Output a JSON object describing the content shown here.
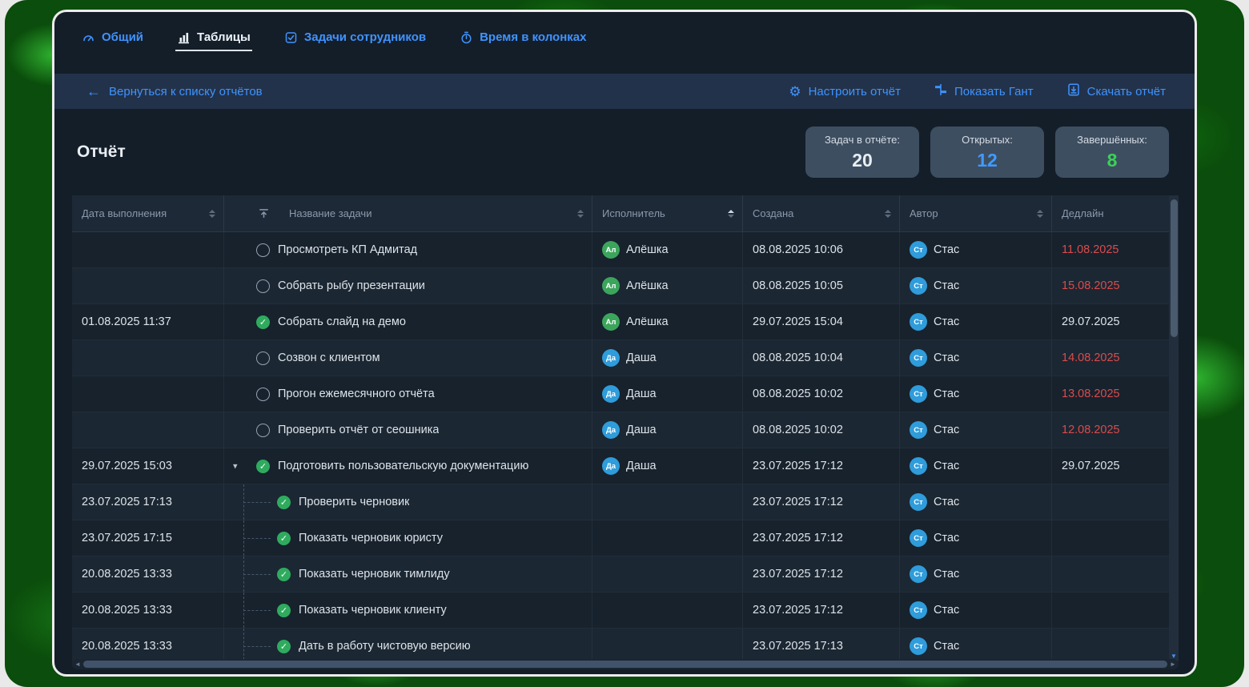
{
  "colors": {
    "accent_blue": "#3f93ff",
    "overdue_red": "#db4b4b",
    "done_green": "#2fab5e",
    "stat_open_blue": "#3f9bff",
    "stat_done_green": "#3bd158",
    "stat_total_white": "#e9eef3"
  },
  "icons": {
    "back": "←",
    "caret_down": "▾",
    "check": "✓",
    "gear": "⚙",
    "scroll_left": "◄",
    "scroll_right": "►",
    "scroll_down": "▼"
  },
  "nav": {
    "tabs": [
      {
        "label": "Общий"
      },
      {
        "label": "Таблицы",
        "active": true
      },
      {
        "label": "Задачи сотрудников"
      },
      {
        "label": "Время в колонках"
      }
    ]
  },
  "toolbar": {
    "back": "Вернуться к списку отчётов",
    "configure": "Настроить отчёт",
    "gantt": "Показать Гант",
    "download": "Скачать отчёт"
  },
  "report": {
    "title": "Отчёт",
    "stats": [
      {
        "label": "Задач в отчёте:",
        "value": "20"
      },
      {
        "label": "Открытых:",
        "value": "12"
      },
      {
        "label": "Завершённых:",
        "value": "8"
      }
    ]
  },
  "table": {
    "headers": {
      "done_date": "Дата выполнения",
      "title": "Название задачи",
      "assignee": "Исполнитель",
      "created": "Создана",
      "author": "Автор",
      "deadline": "Дедлайн"
    },
    "sorted_by": "Исполнитель",
    "rows": [
      {
        "done": "",
        "status": "open",
        "title": "Просмотреть КП Адмитад",
        "assignee": {
          "initials": "Ал",
          "name": "Алёшка",
          "color": "#3ba55c"
        },
        "created": "08.08.2025 10:06",
        "author": {
          "initials": "Ст",
          "name": "Стас",
          "color": "#2f9cdb"
        },
        "deadline": "11.08.2025",
        "overdue": true
      },
      {
        "done": "",
        "status": "open",
        "title": "Собрать рыбу презентации",
        "assignee": {
          "initials": "Ал",
          "name": "Алёшка",
          "color": "#3ba55c"
        },
        "created": "08.08.2025 10:05",
        "author": {
          "initials": "Ст",
          "name": "Стас",
          "color": "#2f9cdb"
        },
        "deadline": "15.08.2025",
        "overdue": true
      },
      {
        "done": "01.08.2025 11:37",
        "status": "done",
        "title": "Собрать слайд на демо",
        "assignee": {
          "initials": "Ал",
          "name": "Алёшка",
          "color": "#3ba55c"
        },
        "created": "29.07.2025 15:04",
        "author": {
          "initials": "Ст",
          "name": "Стас",
          "color": "#2f9cdb"
        },
        "deadline": "29.07.2025",
        "overdue": false
      },
      {
        "done": "",
        "status": "open",
        "title": "Созвон с клиентом",
        "assignee": {
          "initials": "Да",
          "name": "Даша",
          "color": "#2f9cdb"
        },
        "created": "08.08.2025 10:04",
        "author": {
          "initials": "Ст",
          "name": "Стас",
          "color": "#2f9cdb"
        },
        "deadline": "14.08.2025",
        "overdue": true
      },
      {
        "done": "",
        "status": "open",
        "title": "Прогон ежемесячного отчёта",
        "assignee": {
          "initials": "Да",
          "name": "Даша",
          "color": "#2f9cdb"
        },
        "created": "08.08.2025 10:02",
        "author": {
          "initials": "Ст",
          "name": "Стас",
          "color": "#2f9cdb"
        },
        "deadline": "13.08.2025",
        "overdue": true
      },
      {
        "done": "",
        "status": "open",
        "title": "Проверить отчёт от сеошника",
        "assignee": {
          "initials": "Да",
          "name": "Даша",
          "color": "#2f9cdb"
        },
        "created": "08.08.2025 10:02",
        "author": {
          "initials": "Ст",
          "name": "Стас",
          "color": "#2f9cdb"
        },
        "deadline": "12.08.2025",
        "overdue": true
      },
      {
        "done": "29.07.2025 15:03",
        "status": "done",
        "expanded": true,
        "title": "Подготовить пользовательскую документацию",
        "assignee": {
          "initials": "Да",
          "name": "Даша",
          "color": "#2f9cdb"
        },
        "created": "23.07.2025 17:12",
        "author": {
          "initials": "Ст",
          "name": "Стас",
          "color": "#2f9cdb"
        },
        "deadline": "29.07.2025",
        "overdue": false
      },
      {
        "done": "23.07.2025 17:13",
        "status": "done",
        "subtask": true,
        "title": "Проверить черновик",
        "assignee": null,
        "created": "23.07.2025 17:12",
        "author": {
          "initials": "Ст",
          "name": "Стас",
          "color": "#2f9cdb"
        },
        "deadline": "",
        "overdue": false
      },
      {
        "done": "23.07.2025 17:15",
        "status": "done",
        "subtask": true,
        "title": "Показать черновик юристу",
        "assignee": null,
        "created": "23.07.2025 17:12",
        "author": {
          "initials": "Ст",
          "name": "Стас",
          "color": "#2f9cdb"
        },
        "deadline": "",
        "overdue": false
      },
      {
        "done": "20.08.2025 13:33",
        "status": "done",
        "subtask": true,
        "title": "Показать черновик тимлиду",
        "assignee": null,
        "created": "23.07.2025 17:12",
        "author": {
          "initials": "Ст",
          "name": "Стас",
          "color": "#2f9cdb"
        },
        "deadline": "",
        "overdue": false
      },
      {
        "done": "20.08.2025 13:33",
        "status": "done",
        "subtask": true,
        "title": "Показать черновик клиенту",
        "assignee": null,
        "created": "23.07.2025 17:12",
        "author": {
          "initials": "Ст",
          "name": "Стас",
          "color": "#2f9cdb"
        },
        "deadline": "",
        "overdue": false
      },
      {
        "done": "20.08.2025 13:33",
        "status": "done",
        "subtask": true,
        "title": "Дать в работу чистовую версию",
        "assignee": null,
        "created": "23.07.2025 17:13",
        "author": {
          "initials": "Ст",
          "name": "Стас",
          "color": "#2f9cdb"
        },
        "deadline": "",
        "overdue": false
      }
    ]
  }
}
